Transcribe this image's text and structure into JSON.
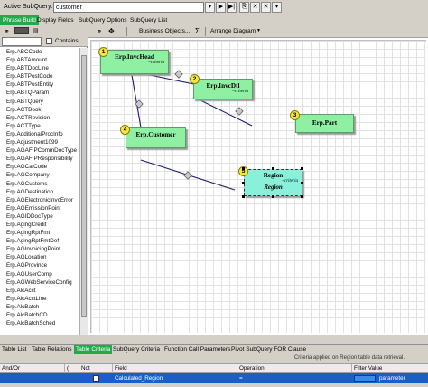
{
  "topbar": {
    "active_subquery_label": "Active SubQuery:",
    "subquery_value": "customer",
    "buttons": [
      "▾",
      "▶",
      "▶|",
      "⎘",
      "✕",
      "✕",
      "▾"
    ]
  },
  "panel_tabs": [
    "Phrase Build",
    "Display Fields",
    "SubQuery Options",
    "SubQuery List"
  ],
  "left_panel": {
    "contains_label": "Contains",
    "items": [
      "Erp.ABCCode",
      "Erp.ABTAmount",
      "Erp.ABTDocLine",
      "Erp.ABTPostCode",
      "Erp.ABTPostEntity",
      "Erp.ABTQParam",
      "Erp.ABTQuery",
      "Erp.ACTBook",
      "Erp.ACTRevision",
      "Erp.ACTType",
      "Erp.AdditionalProcInfo",
      "Erp.Adjustment1099",
      "Erp.AGAFIPCommDocType",
      "Erp.AGAFIPResponsibility",
      "Erp.AGCalCode",
      "Erp.AGCompany",
      "Erp.AGCustoms",
      "Erp.AGDestination",
      "Erp.AGElectronicInvcError",
      "Erp.AGEmissionPoint",
      "Erp.AGIDDocType",
      "Erp.AgingCredit",
      "Erp.AgingRptFmt",
      "Erp.AgingRptFmtDef",
      "Erp.AGInvoicingPoint",
      "Erp.AGLocation",
      "Erp.AGProvince",
      "Erp.AGUserComp",
      "Erp.AGWebServiceConfig",
      "Erp.AlcAcct",
      "Erp.AlcAcctLine",
      "Erp.AlcBatch",
      "Erp.AlcBatchCD",
      "Erp.AlcBatchSched"
    ]
  },
  "designer": {
    "toolbar": {
      "business_objects": "Business Objects...",
      "sigma": "Σ",
      "arrange": "Arrange Diagram"
    },
    "nodes": [
      {
        "num": "1",
        "title": "Erp.InvcHead",
        "criteria": "~criteria"
      },
      {
        "num": "2",
        "title": "Erp.InvcDtl",
        "criteria": "~criteria"
      },
      {
        "num": "3",
        "title": "Erp.Part",
        "criteria": ""
      },
      {
        "num": "4",
        "title": "Erp.Customer",
        "criteria": ""
      },
      {
        "num": "5",
        "title": "Region",
        "criteria": "~criteria",
        "subtitle": "Region"
      }
    ]
  },
  "bottom_tabs": [
    "Table List",
    "Table Relations",
    "Table Criteria",
    "SubQuery Criteria",
    "Function Call Parameters",
    "Pivot SubQuery FOR Clause"
  ],
  "bottom_note": "Criteria applied on Region table data retrieval.",
  "grid": {
    "headers": [
      "And/Or",
      "(",
      "Not",
      "Field",
      "Operation",
      "Filter Value"
    ],
    "row": {
      "andor": "",
      "paren": "",
      "not": "",
      "field": "Calculated_Region",
      "operation": "=",
      "filter_value": "parameter"
    }
  },
  "colors": {
    "active_tab": "#22a94a",
    "node_fill": "#8ff0a4",
    "region_fill": "#89f1d9",
    "selected_row": "#1a5fc8"
  }
}
